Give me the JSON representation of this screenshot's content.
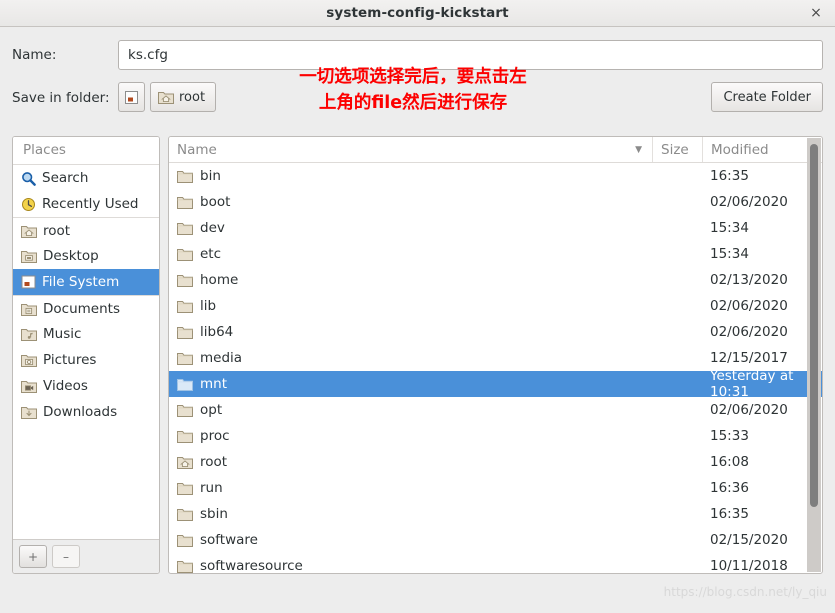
{
  "window": {
    "title": "system-config-kickstart",
    "close_label": "×"
  },
  "form": {
    "name_label": "Name:",
    "name_value": "ks.cfg",
    "name_placeholder": "",
    "folder_label": "Save in folder:",
    "filesystem_button_label": "",
    "root_button_label": "root",
    "create_folder_label": "Create Folder"
  },
  "annotation": {
    "text": "一切选项选择完后，要点击左\n上角的file然后进行保存",
    "color": "#fd0000"
  },
  "places": {
    "header": "Places",
    "items": [
      {
        "label": "Search",
        "icon": "search-icon",
        "selected": false,
        "separator_above": false
      },
      {
        "label": "Recently Used",
        "icon": "recent-icon",
        "selected": false,
        "separator_above": false
      },
      {
        "label": "root",
        "icon": "home-folder-icon",
        "selected": false,
        "separator_above": true
      },
      {
        "label": "Desktop",
        "icon": "desktop-folder-icon",
        "selected": false,
        "separator_above": false
      },
      {
        "label": "File System",
        "icon": "drive-icon",
        "selected": true,
        "separator_above": false
      },
      {
        "label": "Documents",
        "icon": "documents-folder-icon",
        "selected": false,
        "separator_above": true
      },
      {
        "label": "Music",
        "icon": "music-folder-icon",
        "selected": false,
        "separator_above": false
      },
      {
        "label": "Pictures",
        "icon": "pictures-folder-icon",
        "selected": false,
        "separator_above": false
      },
      {
        "label": "Videos",
        "icon": "videos-folder-icon",
        "selected": false,
        "separator_above": false
      },
      {
        "label": "Downloads",
        "icon": "downloads-folder-icon",
        "selected": false,
        "separator_above": false
      }
    ],
    "add_button_label": "+",
    "remove_button_label": "–"
  },
  "filelist": {
    "columns": {
      "name": "Name",
      "size": "Size",
      "modified": "Modified"
    },
    "sort_indicator": "▼",
    "rows": [
      {
        "name": "bin",
        "size": "",
        "modified": "16:35",
        "icon": "folder-icon",
        "selected": false
      },
      {
        "name": "boot",
        "size": "",
        "modified": "02/06/2020",
        "icon": "folder-icon",
        "selected": false
      },
      {
        "name": "dev",
        "size": "",
        "modified": "15:34",
        "icon": "folder-icon",
        "selected": false
      },
      {
        "name": "etc",
        "size": "",
        "modified": "15:34",
        "icon": "folder-icon",
        "selected": false
      },
      {
        "name": "home",
        "size": "",
        "modified": "02/13/2020",
        "icon": "folder-icon",
        "selected": false
      },
      {
        "name": "lib",
        "size": "",
        "modified": "02/06/2020",
        "icon": "folder-icon",
        "selected": false
      },
      {
        "name": "lib64",
        "size": "",
        "modified": "02/06/2020",
        "icon": "folder-icon",
        "selected": false
      },
      {
        "name": "media",
        "size": "",
        "modified": "12/15/2017",
        "icon": "folder-icon",
        "selected": false
      },
      {
        "name": "mnt",
        "size": "",
        "modified": "Yesterday at 10:31",
        "icon": "folder-icon",
        "selected": true
      },
      {
        "name": "opt",
        "size": "",
        "modified": "02/06/2020",
        "icon": "folder-icon",
        "selected": false
      },
      {
        "name": "proc",
        "size": "",
        "modified": "15:33",
        "icon": "folder-icon",
        "selected": false
      },
      {
        "name": "root",
        "size": "",
        "modified": "16:08",
        "icon": "home-folder-icon",
        "selected": false
      },
      {
        "name": "run",
        "size": "",
        "modified": "16:36",
        "icon": "folder-icon",
        "selected": false
      },
      {
        "name": "sbin",
        "size": "",
        "modified": "16:35",
        "icon": "folder-icon",
        "selected": false
      },
      {
        "name": "software",
        "size": "",
        "modified": "02/15/2020",
        "icon": "folder-icon",
        "selected": false
      },
      {
        "name": "softwaresource",
        "size": "",
        "modified": "10/11/2018",
        "icon": "folder-icon",
        "selected": false
      }
    ]
  },
  "watermark": {
    "text": "https://blog.csdn.net/ly_qiu"
  },
  "colors": {
    "selection": "#4a90d9",
    "annotation": "#fd0000",
    "window_bg": "#ededed",
    "list_bg": "#ffffff"
  }
}
